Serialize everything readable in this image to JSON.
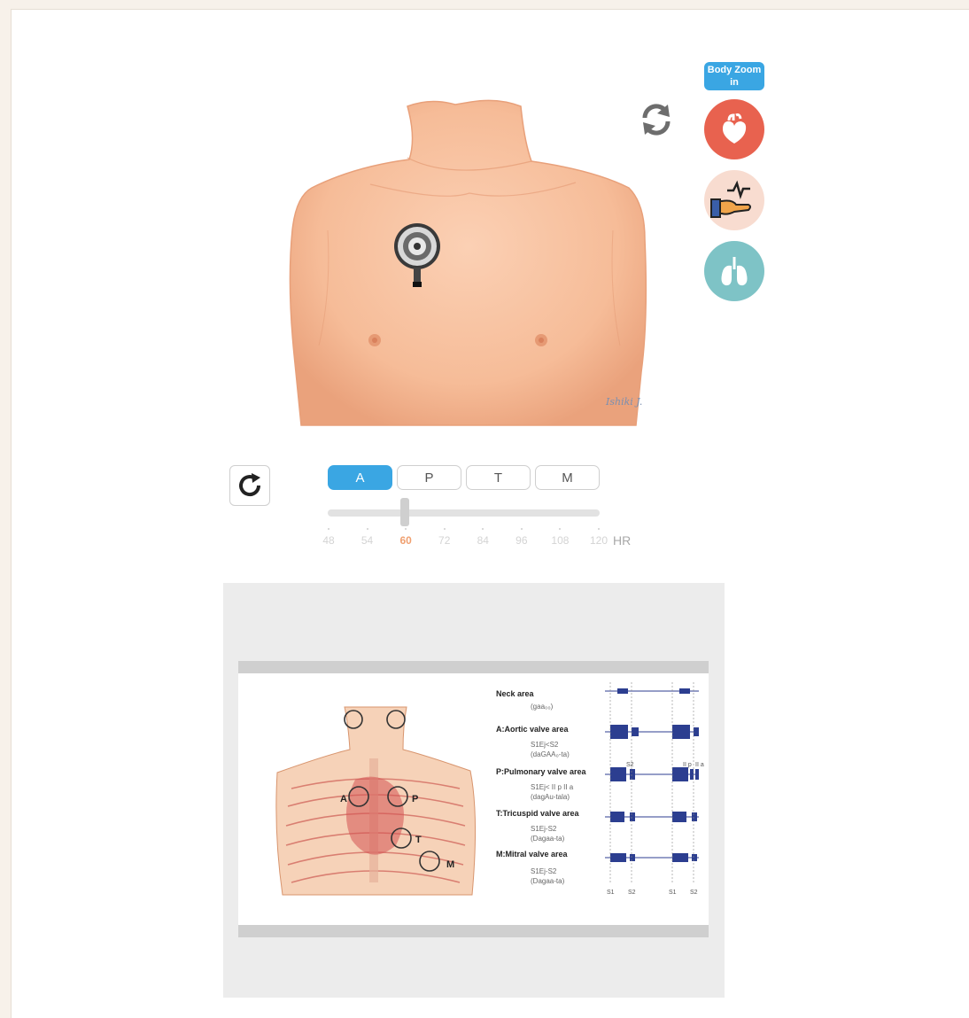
{
  "toolbar": {
    "zoom_label": "Body Zoom in",
    "reload_icon": "refresh-arrows-icon",
    "heart_icon": "heart-icon",
    "pulse_icon": "pulse-hand-icon",
    "lung_icon": "lungs-icon",
    "colors": {
      "accent": "#3aa6e3",
      "heart": "#e8624f",
      "pulse_bg": "#f8dcd0",
      "lung": "#7ec3c6"
    }
  },
  "illustration": {
    "signature": "Ishiki J."
  },
  "controls": {
    "replay_icon": "replay-icon",
    "segments": [
      {
        "label": "A",
        "active": true
      },
      {
        "label": "P",
        "active": false
      },
      {
        "label": "T",
        "active": false
      },
      {
        "label": "M",
        "active": false
      }
    ],
    "hr": {
      "ticks": [
        "48",
        "54",
        "60",
        "72",
        "84",
        "96",
        "108",
        "120"
      ],
      "selected": "60",
      "unit": "HR"
    }
  },
  "reference": {
    "areas": [
      {
        "title": "Neck area",
        "sub1": "(gaa₀₀)",
        "sub2": ""
      },
      {
        "title": "A:Aortic valve area",
        "sub1": "S1Ej<S2",
        "sub2": "(daGAA₀-ta)"
      },
      {
        "title": "P:Pulmonary valve area",
        "sub1": "S1Ej< II p II a",
        "sub2": "(dagAu-tala)"
      },
      {
        "title": "T:Tricuspid valve area",
        "sub1": "S1Ej-S2",
        "sub2": "(Dagaa-ta)"
      },
      {
        "title": "M:Mitral valve area",
        "sub1": "S1Ej-S2",
        "sub2": "(Dagaa-ta)"
      }
    ],
    "markers": [
      "A",
      "P",
      "T",
      "M"
    ],
    "wave_labels": [
      "S2",
      "II p",
      "II a"
    ],
    "axis_labels": [
      "S1",
      "S2",
      "S1",
      "S2"
    ]
  }
}
